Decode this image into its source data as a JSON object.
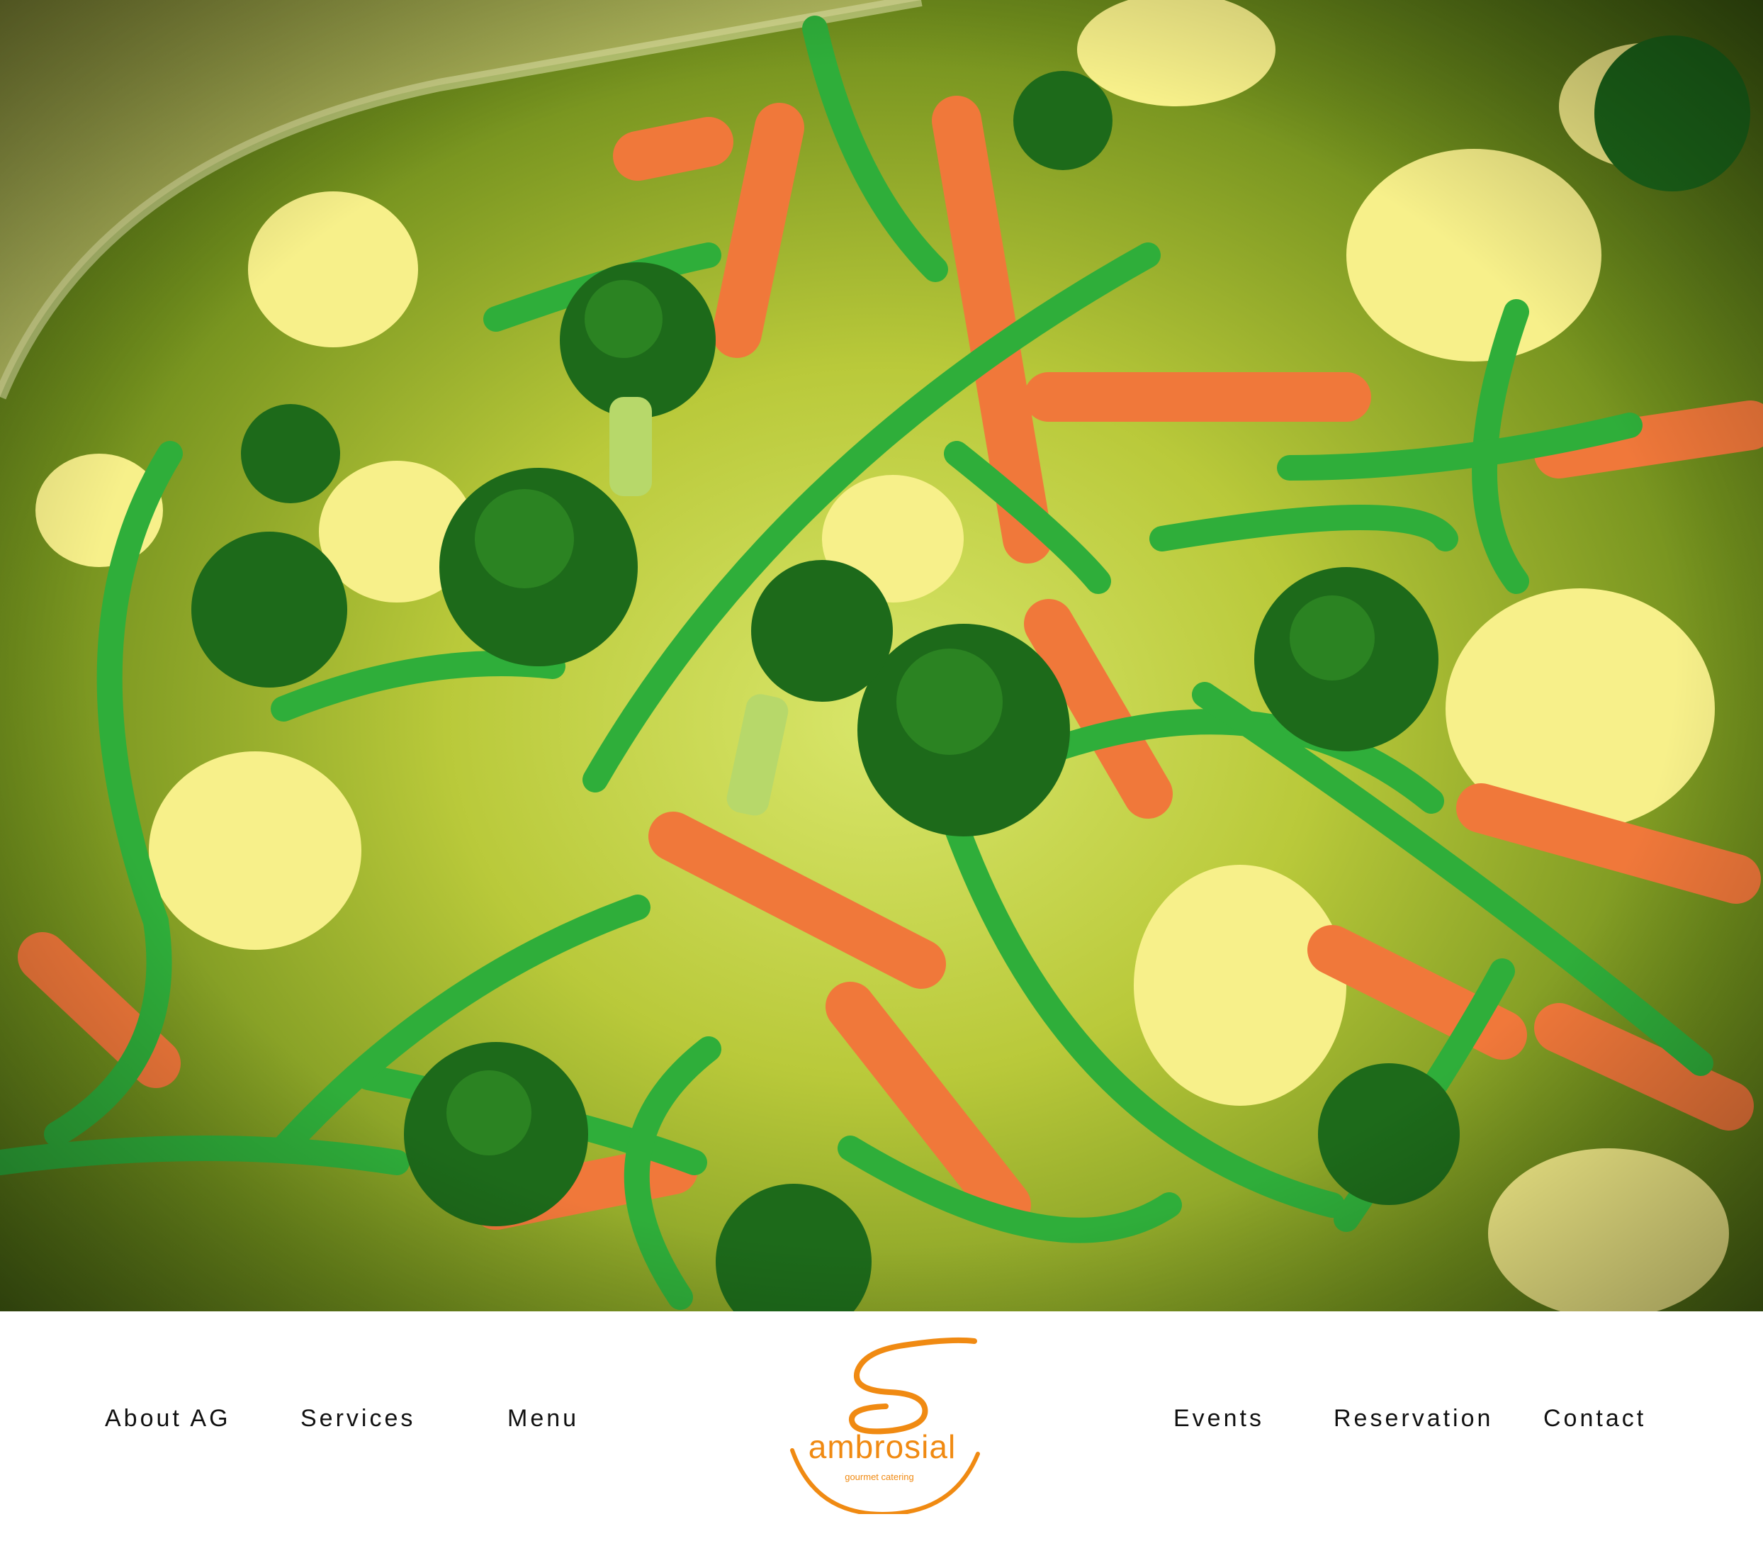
{
  "hero": {
    "image_subject": "steamed mixed vegetables",
    "icon": "vegetables-photo"
  },
  "nav": {
    "left": [
      {
        "label": "About AG"
      },
      {
        "label": "Services"
      },
      {
        "label": "Menu"
      }
    ],
    "right": [
      {
        "label": "Events"
      },
      {
        "label": "Reservation"
      },
      {
        "label": "Contact"
      }
    ]
  },
  "logo": {
    "wordmark": "ambrosial",
    "tagline": "gourmet catering",
    "brand_color": "#f08a12"
  },
  "colors": {
    "background": "#ffffff",
    "nav_text": "#111111",
    "accent": "#f08a12"
  }
}
